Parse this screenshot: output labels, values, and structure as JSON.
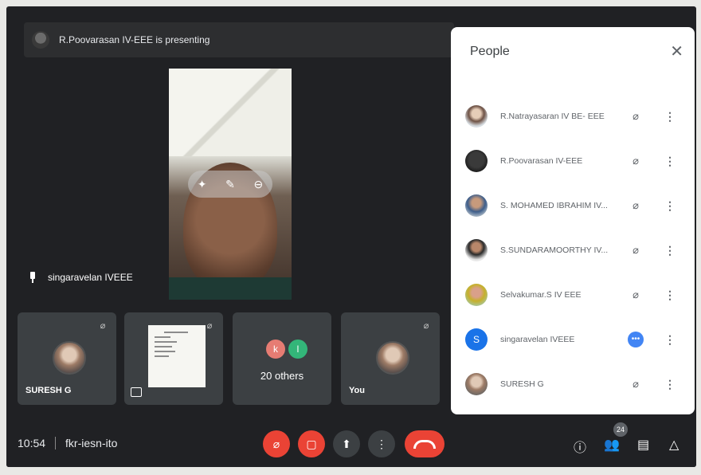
{
  "presentation": {
    "banner": "R.Poovarasan IV-EEE is presenting"
  },
  "speaker": {
    "name": "singaravelan IVEEE"
  },
  "tiles": [
    {
      "name": "SURESH G"
    },
    {
      "name": ""
    },
    {
      "name": "20 others",
      "initials": [
        "k",
        "l"
      ],
      "colors": [
        "#e67c73",
        "#33b679"
      ]
    },
    {
      "name": "You"
    }
  ],
  "meeting": {
    "time": "10:54",
    "code": "fkr-iesn-ito"
  },
  "controls": {
    "people_count": "24"
  },
  "people_panel": {
    "title": "People",
    "participants": [
      {
        "name": "R.Natrayasaran IV BE- EEE",
        "status": "muted"
      },
      {
        "name": "R.Poovarasan IV-EEE",
        "status": "muted"
      },
      {
        "name": "S. MOHAMED IBRAHIM IV...",
        "status": "muted"
      },
      {
        "name": "S.SUNDARAMOORTHY IV...",
        "status": "muted"
      },
      {
        "name": "Selvakumar.S IV EEE",
        "status": "muted"
      },
      {
        "name": "singaravelan IVEEE",
        "status": "speaking",
        "initial": "S"
      },
      {
        "name": "SURESH G",
        "status": "muted"
      }
    ]
  },
  "colors": {
    "accent": "#1a73e8",
    "danger": "#ea4335",
    "background": "#202124"
  },
  "icons": [
    "mic-off-icon",
    "camera-off-icon",
    "present-icon",
    "more-icon",
    "hangup-icon",
    "info-icon",
    "people-icon",
    "chat-icon",
    "activities-icon",
    "close-icon",
    "pin-icon"
  ]
}
